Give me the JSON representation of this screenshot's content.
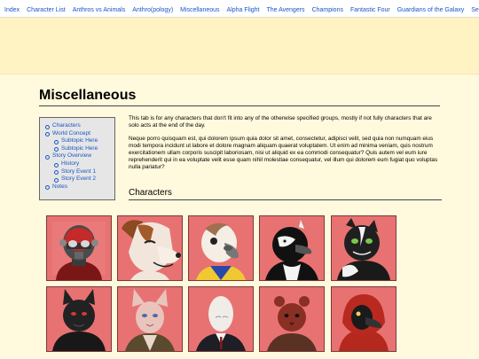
{
  "nav": {
    "items": [
      "Index",
      "Character List",
      "Anthros vs Animals",
      "Anthro(pology)",
      "Miscellaneous",
      "Alpha Flight",
      "The Avengers",
      "Champions",
      "Fantastic Four",
      "Guardians of the Galaxy",
      "Sea"
    ]
  },
  "page": {
    "title": "Miscellaneous",
    "intro": "This tab is for any characters that don't fit into any of the otherwise specified groups, mostly if not fully characters that are solo acts at the end of the day.",
    "lorem": "Neque porro quisquam est, qui dolorem ipsum quia dolor sit amet, consectetur, adipisci velit, sed quia non numquam eius modi tempora incidunt ut labore et dolore magnam aliquam quaerat voluptatem. Ut enim ad minima veniam, quis nostrum exercitationem ullam corporis suscipit laboriosam, nisi ut aliquid ex ea commodi consequatur? Quis autem vel eum iure reprehenderit qui in ea voluptate velit esse quam nihil molestiae consequatur, vel illum qui dolorem eum fugiat quo voluptas nulla pariatur?",
    "characters_heading": "Characters"
  },
  "toc": {
    "characters": "Characters",
    "world_concept": "World Concept",
    "subtopic_1": "Subtopic Here",
    "subtopic_2": "Subtopic Here",
    "story_overview": "Story Overview",
    "history": "History",
    "story_event_1": "Story Event 1",
    "story_event_2": "Story Event 2",
    "notes": "Notes"
  },
  "colors": {
    "link": "#1a55c6",
    "card_bg": "#e87272",
    "page_bg": "#fff9dd",
    "banner_bg": "#fff3c4"
  }
}
